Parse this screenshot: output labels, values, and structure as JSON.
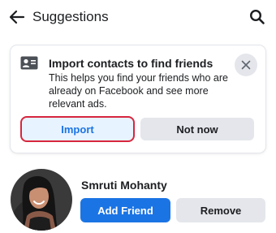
{
  "header": {
    "title": "Suggestions",
    "back_icon": "arrow-left-icon",
    "search_icon": "search-icon"
  },
  "import_card": {
    "icon": "contacts-card-icon",
    "title": "Import contacts to find friends",
    "description": "This helps you find your friends who are already on Facebook and see more relevant ads.",
    "close_icon": "close-icon",
    "import_label": "Import",
    "not_now_label": "Not now"
  },
  "suggestion": {
    "name": "Smruti Mohanty",
    "add_friend_label": "Add Friend",
    "remove_label": "Remove"
  },
  "colors": {
    "accent": "#1b74e4",
    "accent_light": "#e7f3ff",
    "secondary_button": "#e4e6eb",
    "highlight_border": "#d7263d"
  }
}
